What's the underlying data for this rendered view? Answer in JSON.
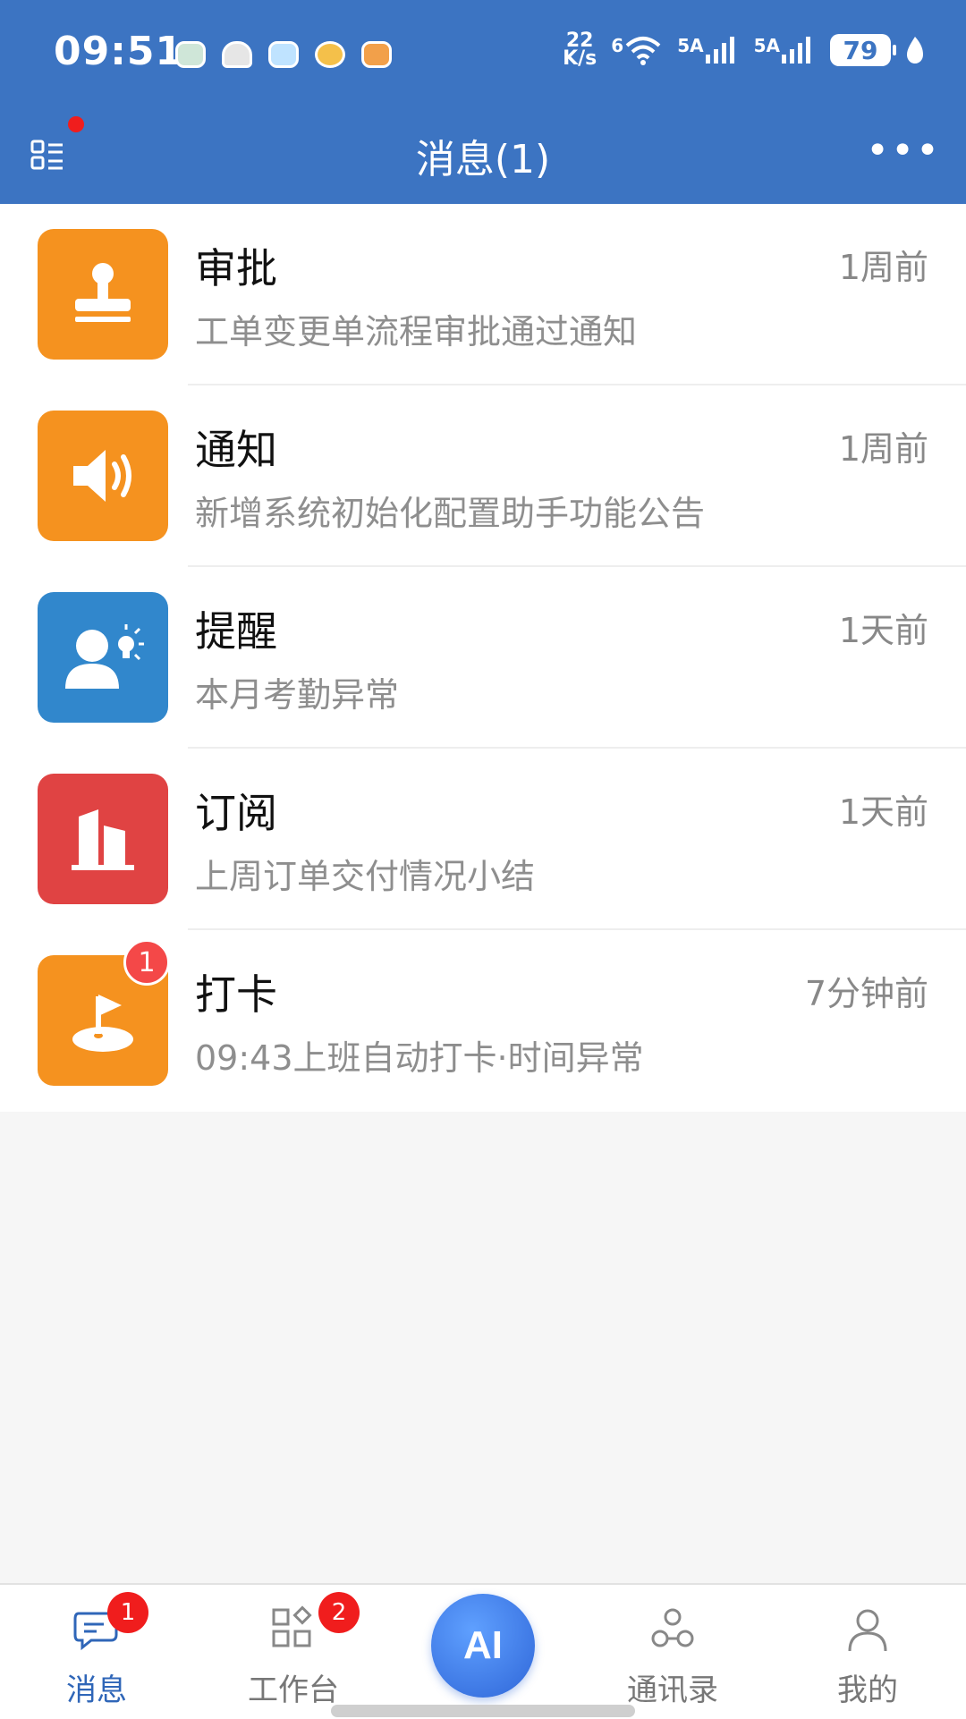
{
  "status_bar": {
    "time": "09:51",
    "net_speed_top": "22",
    "net_speed_bottom": "K/s",
    "wifi_label": "6",
    "signal1": "5A",
    "signal2": "5A",
    "battery": "79"
  },
  "header": {
    "title": "消息(1)",
    "more": "•••"
  },
  "messages": [
    {
      "title": "审批",
      "subtitle": "工单变更单流程审批通过通知",
      "time": "1周前",
      "icon": "stamp-icon",
      "color": "#f5921f"
    },
    {
      "title": "通知",
      "subtitle": "新增系统初始化配置助手功能公告",
      "time": "1周前",
      "icon": "speaker-icon",
      "color": "#f5921f"
    },
    {
      "title": "提醒",
      "subtitle": "本月考勤异常",
      "time": "1天前",
      "icon": "person-bulb-icon",
      "color": "#3187cc"
    },
    {
      "title": "订阅",
      "subtitle": "上周订单交付情况小结",
      "time": "1天前",
      "icon": "building-icon",
      "color": "#e04343"
    },
    {
      "title": "打卡",
      "subtitle": "09:43上班自动打卡·时间异常",
      "time": "7分钟前",
      "icon": "flag-icon",
      "color": "#f5921f",
      "badge": "1"
    }
  ],
  "tabbar": {
    "messages": {
      "label": "消息",
      "badge": "1"
    },
    "workbench": {
      "label": "工作台",
      "badge": "2"
    },
    "ai": {
      "label": "AI"
    },
    "contacts": {
      "label": "通讯录"
    },
    "mine": {
      "label": "我的"
    }
  },
  "colors": {
    "header_bg": "#3c74c2",
    "active_tab": "#2f66b8",
    "badge_red": "#f01d1d"
  }
}
